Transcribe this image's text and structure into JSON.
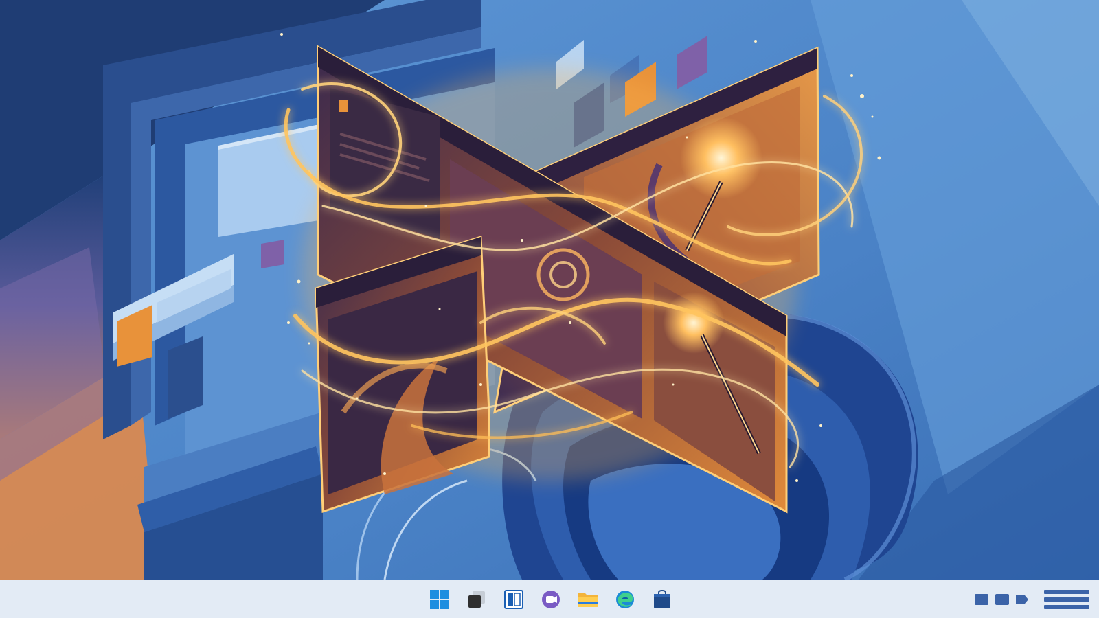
{
  "colors": {
    "desktop_base": "#4d86cb",
    "taskbar_bg": "#e3ebf5",
    "accent_orange": "#e8923a",
    "accent_purple": "#7f61a8",
    "accent_blue": "#2c5aa8",
    "glow": "#ffc970"
  },
  "taskbar": {
    "pinned": [
      {
        "name": "start-button",
        "icon": "windows-logo-icon"
      },
      {
        "name": "task-view-button",
        "icon": "task-view-icon"
      },
      {
        "name": "widgets-button",
        "icon": "widgets-icon"
      },
      {
        "name": "chat-button",
        "icon": "chat-icon"
      },
      {
        "name": "file-explorer-button",
        "icon": "folder-icon"
      },
      {
        "name": "edge-button",
        "icon": "edge-browser-icon"
      },
      {
        "name": "store-button",
        "icon": "store-bag-icon"
      }
    ],
    "tray": [
      {
        "name": "tray-network",
        "icon": "network-icon"
      },
      {
        "name": "tray-volume",
        "icon": "volume-icon"
      },
      {
        "name": "tray-battery",
        "icon": "battery-icon"
      },
      {
        "name": "tray-clock",
        "icon": "clock-placeholder-icon"
      }
    ]
  }
}
